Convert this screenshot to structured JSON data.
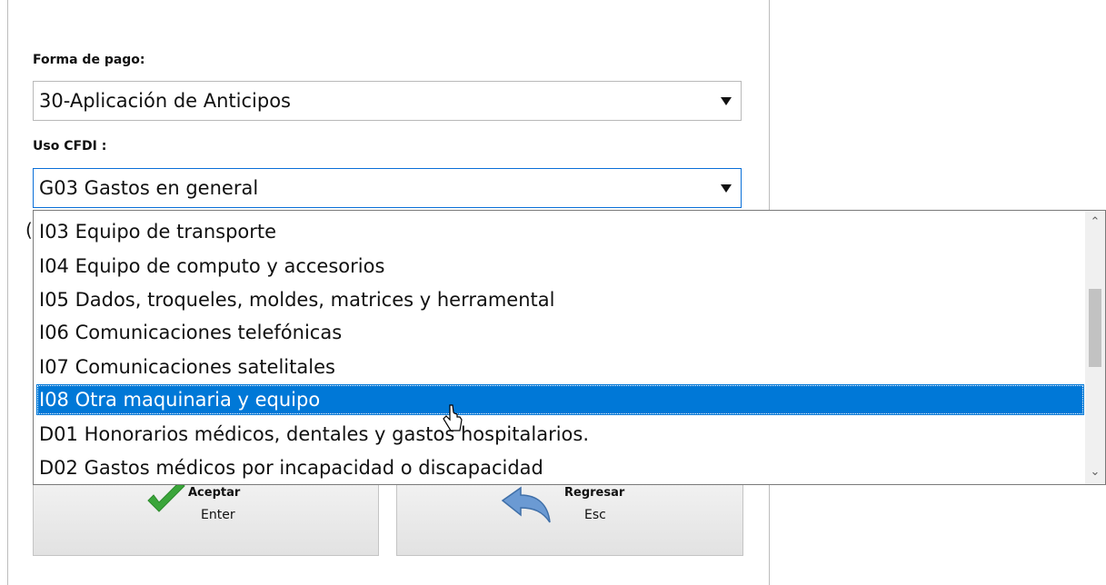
{
  "form": {
    "forma_pago_label": "Forma de pago:",
    "forma_pago_value": "30-Aplicación de Anticipos",
    "uso_cfdi_label": "Uso CFDI :",
    "uso_cfdi_value": "G03 Gastos en general"
  },
  "dropdown": {
    "options": [
      "I03 Equipo de transporte",
      "I04 Equipo de computo y accesorios",
      "I05 Dados, troqueles, moldes, matrices y herramental",
      "I06 Comunicaciones telefónicas",
      "I07 Comunicaciones satelitales",
      "I08 Otra maquinaria y equipo",
      "D01 Honorarios médicos, dentales y gastos hospitalarios.",
      "D02 Gastos médicos por incapacidad o discapacidad"
    ],
    "highlighted_option": "I08 Otra maquinaria y equipo",
    "scroll_up_icon": "chevron-up-icon",
    "scroll_down_icon": "chevron-down-icon"
  },
  "buttons": {
    "accept_label": "Aceptar",
    "accept_key": "Enter",
    "accept_icon": "checkmark-icon",
    "back_label": "Regresar",
    "back_key": "Esc",
    "back_icon": "back-arrow-icon"
  },
  "colors": {
    "selection": "#0078d7",
    "focus_border": "#0a6fd8",
    "check_green": "#3aa53a",
    "back_arrow_blue": "#5b8fc9"
  }
}
